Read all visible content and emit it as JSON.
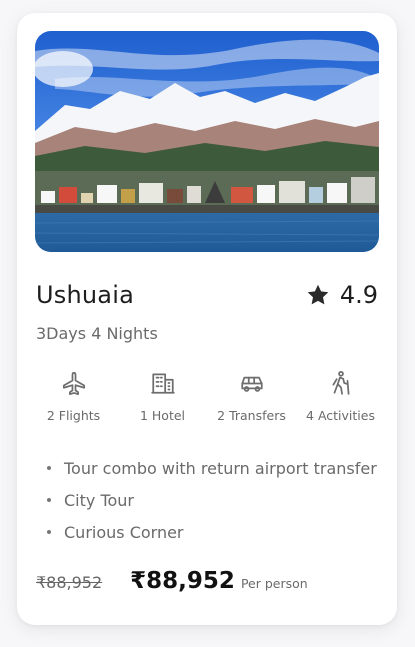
{
  "card": {
    "destination": "Ushuaia",
    "rating": "4.9",
    "duration": "3Days 4 Nights",
    "features": [
      {
        "icon": "plane-icon",
        "label": "2 Flights"
      },
      {
        "icon": "hotel-icon",
        "label": "1 Hotel"
      },
      {
        "icon": "car-icon",
        "label": "2 Transfers"
      },
      {
        "icon": "hiker-icon",
        "label": "4 Activities"
      }
    ],
    "highlights": [
      "Tour combo with return airport transfer",
      "City Tour",
      "Curious Corner"
    ],
    "price": {
      "original": "₹88,952",
      "current": "₹88,952",
      "unit": "Per person"
    }
  },
  "colors": {
    "card_background": "#ffffff",
    "page_background": "#f7f7f9",
    "text_primary": "#1e1e1e",
    "text_secondary": "#6a6a6a"
  }
}
